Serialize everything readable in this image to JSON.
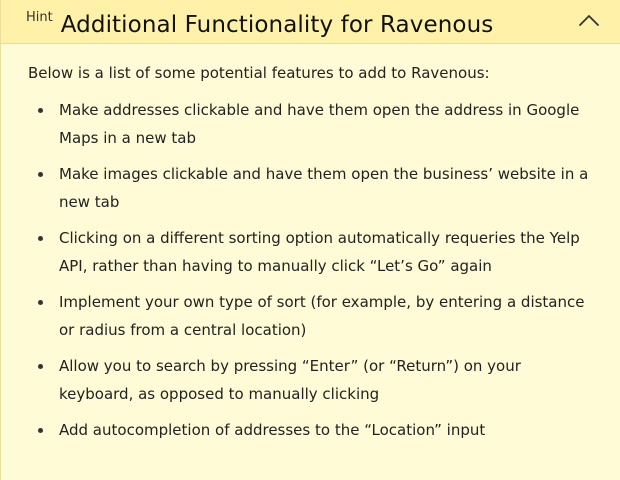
{
  "hint": {
    "tag": "Hint",
    "title": "Additional Functionality for Ravenous",
    "collapse_icon": "chevron-up-icon",
    "intro": "Below is a list of some potential features to add to Ravenous:",
    "items": [
      "Make addresses clickable and have them open the address in Google Maps in a new tab",
      "Make images clickable and have them open the business’ website in a new tab",
      "Clicking on a different sorting option automatically requeries the Yelp API, rather than having to manually click “Let’s Go” again",
      "Implement your own type of sort (for example, by entering a distance or radius from a central location)",
      "Allow you to search by pressing “Enter” (or “Return”) on your keyboard, as opposed to manually clicking",
      "Add autocompletion of addresses to the “Location” input"
    ]
  },
  "colors": {
    "header_bg": "#fff2a8",
    "body_bg": "#fffbd6"
  }
}
